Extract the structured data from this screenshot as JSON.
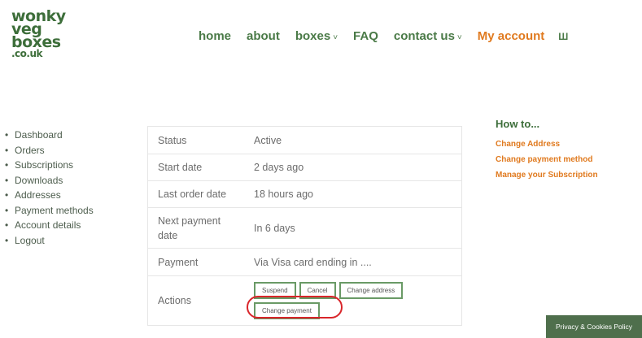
{
  "logo": {
    "line1": "wonky",
    "line2": "veg",
    "line3": "boxes",
    "line4": ".co.uk"
  },
  "nav": {
    "home": "home",
    "about": "about",
    "boxes": "boxes",
    "faq": "FAQ",
    "contact": "contact us",
    "account": "My account",
    "cart_icon": "Ш",
    "caret": "˅"
  },
  "sidebar": {
    "items": [
      "Dashboard",
      "Orders",
      "Subscriptions",
      "Downloads",
      "Addresses",
      "Payment methods",
      "Account details",
      "Logout"
    ],
    "bullet": "•"
  },
  "subscription": {
    "status_label": "Status",
    "status_value": "Active",
    "start_label": "Start date",
    "start_value": "2 days ago",
    "last_order_label": "Last order date",
    "last_order_value": "18 hours ago",
    "next_payment_label": "Next payment date",
    "next_payment_value": "In 6 days",
    "payment_label": "Payment",
    "payment_value": "Via Visa card ending in ....",
    "actions_label": "Actions",
    "actions": {
      "suspend": "Suspend",
      "cancel": "Cancel",
      "change_address": "Change address",
      "change_payment": "Change payment"
    }
  },
  "howto": {
    "title": "How to...",
    "links": [
      "Change Address",
      "Change payment method",
      "Manage your Subscription"
    ]
  },
  "privacy": "Privacy & Cookies Policy",
  "colors": {
    "brand_green": "#3d6e3a",
    "accent_orange": "#e07a1f",
    "highlight_red": "#d9252a"
  }
}
